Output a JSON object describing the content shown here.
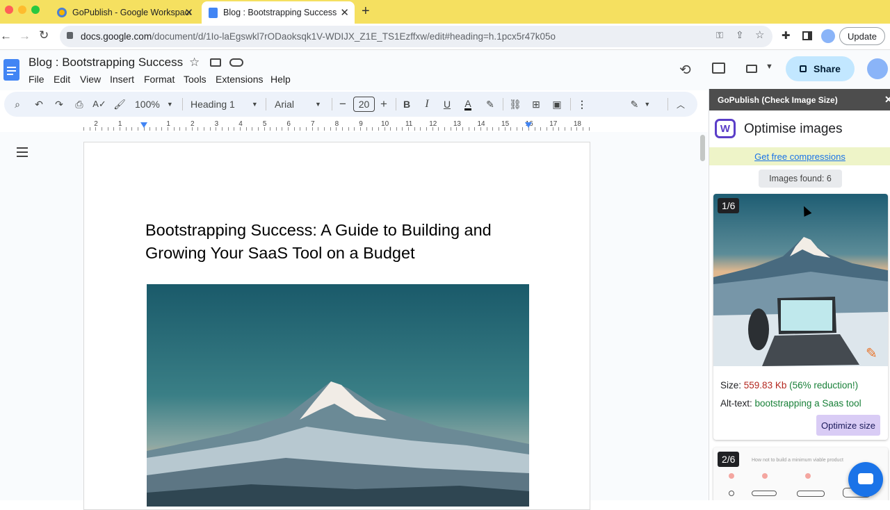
{
  "browser": {
    "tabs": [
      {
        "title": "GoPublish - Google Workspace",
        "active": false
      },
      {
        "title": "Blog : Bootstrapping Success",
        "active": true
      }
    ],
    "url_host": "docs.google.com",
    "url_path": "/document/d/1Io-laEgswkl7rODaoksqk1V-WDIJX_Z1E_TS1Ezffxw/edit#heading=h.1pcx5r47k05o",
    "update_label": "Update"
  },
  "docs": {
    "title": "Blog : Bootstrapping Success",
    "menu": [
      "File",
      "Edit",
      "View",
      "Insert",
      "Format",
      "Tools",
      "Extensions",
      "Help"
    ],
    "share_label": "Share",
    "toolbar": {
      "zoom": "100%",
      "style": "Heading 1",
      "font": "Arial",
      "font_size": "20"
    },
    "ruler_numbers": [
      "2",
      "1",
      "1",
      "2",
      "3",
      "4",
      "5",
      "6",
      "7",
      "8",
      "9",
      "10",
      "11",
      "12",
      "13",
      "14",
      "15",
      "16",
      "17",
      "18"
    ],
    "heading": "Bootstrapping Success: A Guide to Building and Growing Your SaaS Tool on a Budget"
  },
  "panel": {
    "header": "GoPublish (Check Image Size)",
    "logo_letter": "W",
    "title": "Optimise images",
    "promo_link": "Get free compressions",
    "images_found": "Images found: 6",
    "card1": {
      "counter": "1/6",
      "size_label": "Size:",
      "size_value": "559.83 Kb",
      "reduction": "(56% reduction!)",
      "alt_label": "Alt-text:",
      "alt_value": "bootstrapping a Saas tool",
      "button": "Optimize size"
    },
    "card2": {
      "counter": "2/6",
      "caption": "How not to build a minimum viable product"
    }
  },
  "colors": {
    "tabstrip": "#f5e060",
    "size_value": "#b3261e",
    "reduction": "#188038",
    "alt_value": "#188038",
    "share_bg": "#c2e7ff",
    "chat_fab": "#1a73e8"
  }
}
